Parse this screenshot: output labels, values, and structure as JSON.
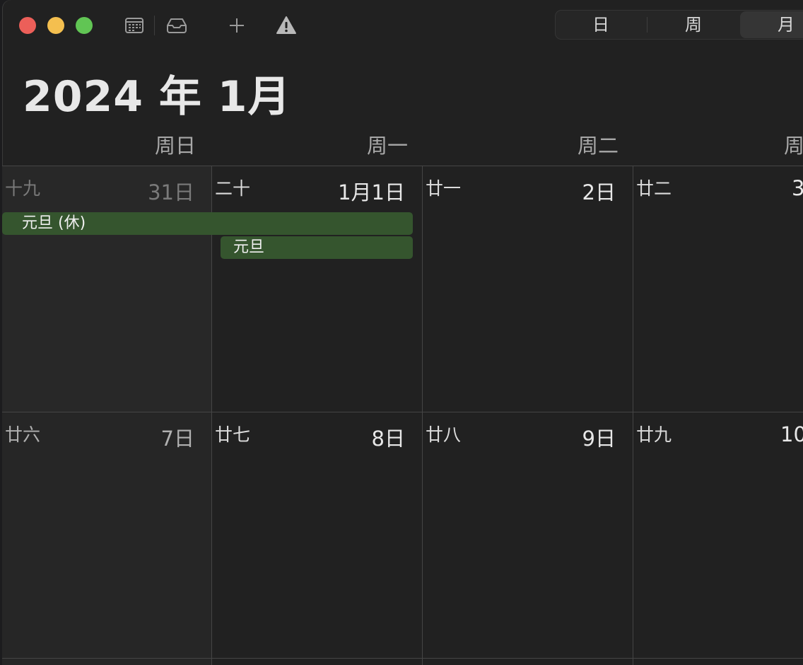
{
  "toolbar": {
    "icons": [
      "calendar-list-icon",
      "inbox-icon",
      "plus-icon",
      "warning-icon"
    ],
    "views": [
      "日",
      "周",
      "月"
    ],
    "active_view": "月"
  },
  "title": "2024 年 1月",
  "weekdays": [
    "周日",
    "周一",
    "周二",
    "周"
  ],
  "weeks": [
    [
      {
        "lunar": "十九",
        "day": "31日",
        "outside": true
      },
      {
        "lunar": "二十",
        "day": "1月1日"
      },
      {
        "lunar": "廿一",
        "day": "2日"
      },
      {
        "lunar": "廿二",
        "day": "3"
      }
    ],
    [
      {
        "lunar": "廿六",
        "day": "7日",
        "weekend": true
      },
      {
        "lunar": "廿七",
        "day": "8日"
      },
      {
        "lunar": "廿八",
        "day": "9日"
      },
      {
        "lunar": "廿九",
        "day": "10"
      }
    ]
  ],
  "events": [
    {
      "label": "元旦 (休)"
    },
    {
      "label": "元旦"
    }
  ],
  "colors": {
    "event": "#35552e",
    "close": "#ec5f59",
    "minimize": "#f4bf4f",
    "zoom": "#61c554"
  }
}
